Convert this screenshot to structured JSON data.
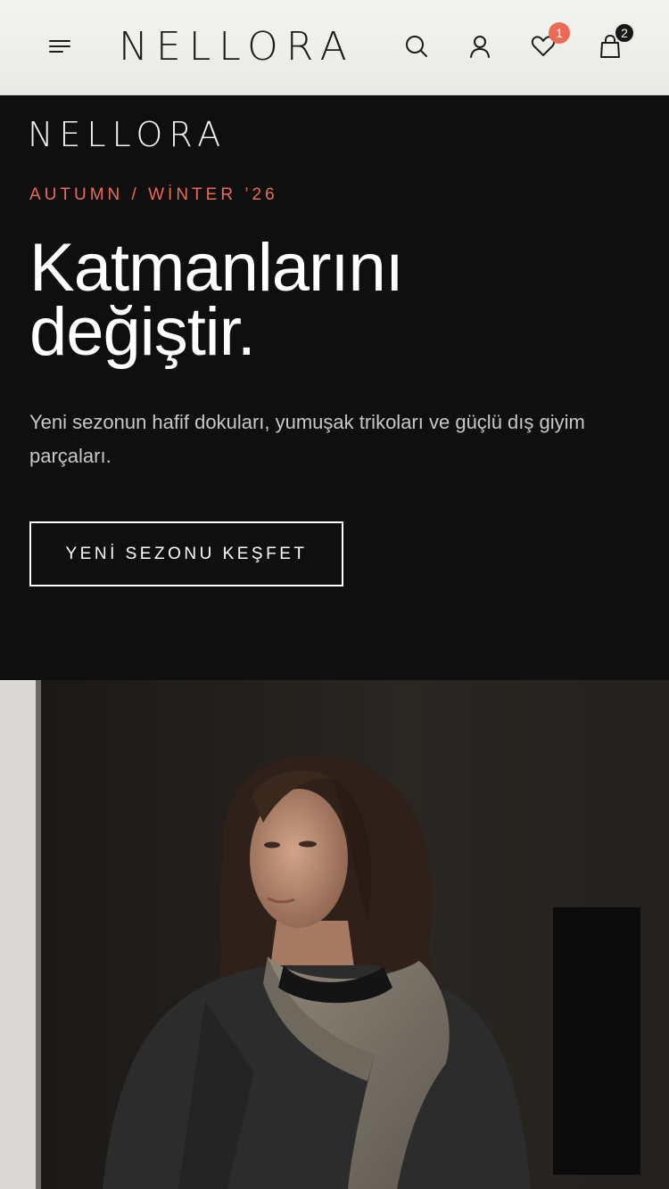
{
  "header": {
    "brand": "NELLORA",
    "wishlist_count": "1",
    "cart_count": "2",
    "icons": [
      "menu-icon",
      "search-icon",
      "user-icon",
      "heart-icon",
      "bag-icon"
    ]
  },
  "hero": {
    "brand": "NELLORA",
    "eyebrow": "AUTUMN / WİNTER ’26",
    "headline_line1": "Katmanlarını",
    "headline_line2": "değiştir.",
    "subtitle": "Yeni sezonun hafif dokuları, yumuşak trikoları ve güçlü dış giyim parçaları.",
    "cta_label": "YENİ SEZONU KEŞFET"
  },
  "colors": {
    "accent": "#ec6b57",
    "hero_bg": "#0f0f10",
    "header_bg": "#eeeeea",
    "text_light": "#ffffff"
  }
}
